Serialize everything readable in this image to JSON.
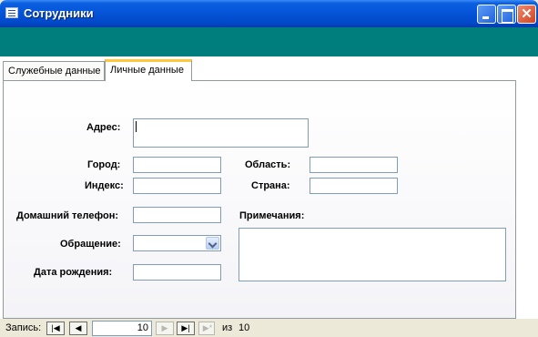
{
  "window": {
    "title": "Сотрудники"
  },
  "tabs": [
    {
      "label": "Служебные данные"
    },
    {
      "label": "Личные данные"
    }
  ],
  "form": {
    "address_label": "Адрес:",
    "city_label": "Город:",
    "region_label": "Область:",
    "postal_label": "Индекс:",
    "country_label": "Страна:",
    "home_phone_label": "Домашний телефон:",
    "notes_label": "Примечания:",
    "title_of_courtesy_label": "Обращение:",
    "birth_date_label": "Дата рождения:"
  },
  "navigation": {
    "record_label": "Запись:",
    "current_record": "10",
    "of_label": "из",
    "total": "10"
  },
  "colors": {
    "header_band": "#007d7d",
    "active_tab_accent": "#ffc83c"
  }
}
